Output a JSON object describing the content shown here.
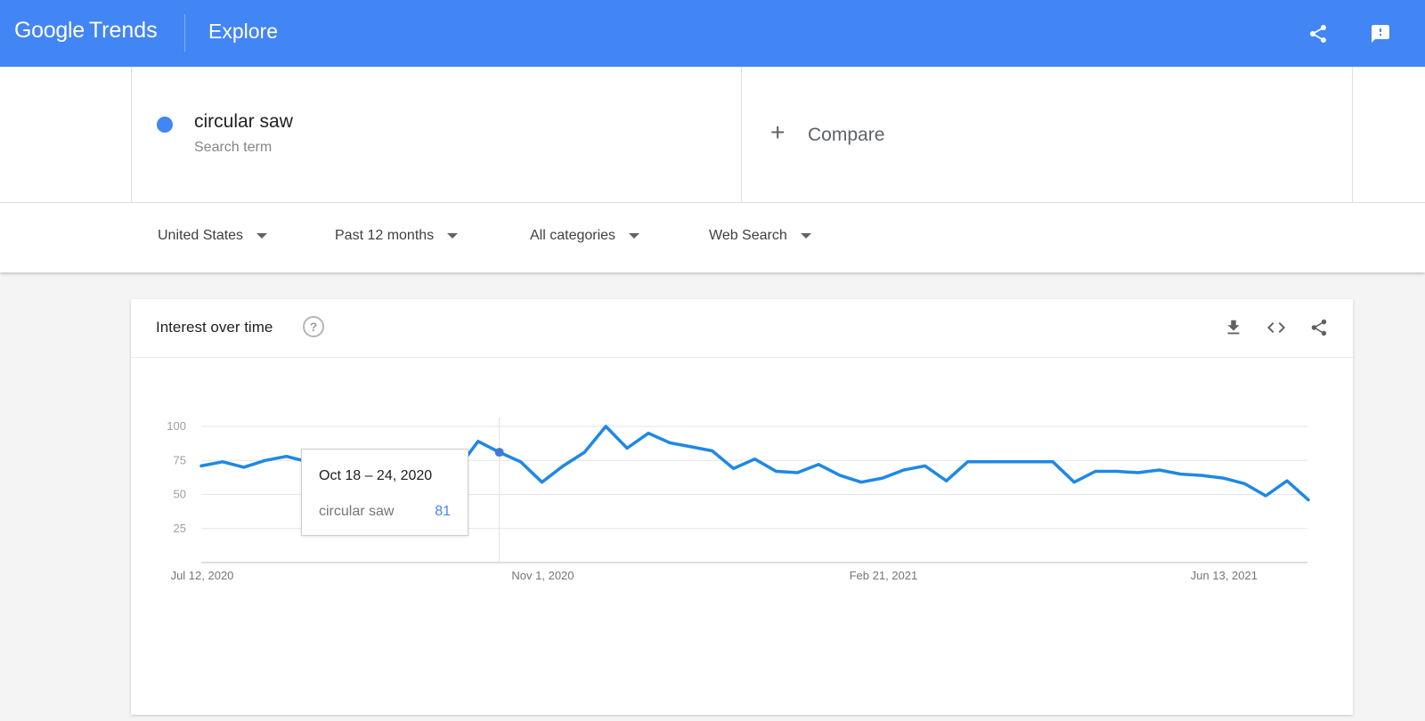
{
  "header": {
    "brand_google": "Google",
    "brand_trends": "Trends",
    "page": "Explore",
    "share_icon": "share-icon",
    "feedback_icon": "feedback-icon"
  },
  "search": {
    "term": "circular saw",
    "term_type": "Search term",
    "term_color": "#4285f4",
    "compare_symbol": "+",
    "compare_label": "Compare"
  },
  "filters": [
    {
      "label": "United States"
    },
    {
      "label": "Past 12 months"
    },
    {
      "label": "All categories"
    },
    {
      "label": "Web Search"
    }
  ],
  "card": {
    "title": "Interest over time",
    "help_symbol": "?",
    "actions": [
      "download-icon",
      "embed-icon",
      "share-icon"
    ]
  },
  "tooltip": {
    "date": "Oct 18 – 24, 2020",
    "series": "circular saw",
    "value": "81"
  },
  "chart_data": {
    "type": "line",
    "series": [
      {
        "name": "circular saw",
        "color": "#1e88e5",
        "values": [
          71,
          74,
          70,
          75,
          78,
          74,
          74,
          78,
          70,
          65,
          72,
          68,
          68,
          89,
          81,
          74,
          59,
          71,
          81,
          100,
          84,
          95,
          88,
          85,
          82,
          69,
          76,
          67,
          66,
          72,
          64,
          59,
          62,
          68,
          71,
          60,
          74,
          74,
          74,
          74,
          74,
          59,
          67,
          67,
          66,
          68,
          65,
          64,
          62,
          58,
          49,
          60,
          46
        ]
      }
    ],
    "x_start": "Jul 12, 2020",
    "x_ticks": [
      {
        "index": 0,
        "label": "Jul 12, 2020"
      },
      {
        "index": 16,
        "label": "Nov 1, 2020"
      },
      {
        "index": 32,
        "label": "Feb 21, 2021"
      },
      {
        "index": 48,
        "label": "Jun 13, 2021"
      }
    ],
    "y_ticks": [
      100,
      75,
      50,
      25
    ],
    "ylim": [
      0,
      100
    ],
    "highlight_index": 14,
    "grid": true,
    "legend": "none"
  }
}
